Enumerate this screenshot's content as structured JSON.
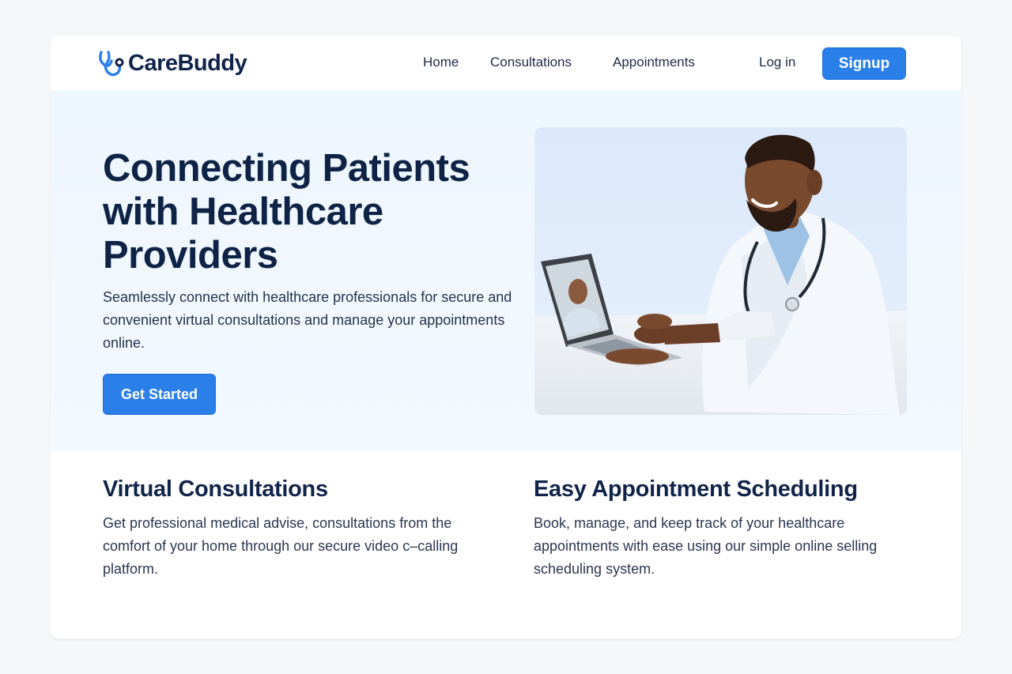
{
  "brand": {
    "name": "CareBuddy",
    "icon": "stethoscope-icon",
    "color": "#2a7fe8"
  },
  "nav": {
    "home": "Home",
    "consultations": "Consultations",
    "appointments": "Appointments",
    "login": "Log in",
    "signup": "Signup"
  },
  "hero": {
    "title": "Connecting Patients with Healthcare Providers",
    "subtitle": "Seamlessly connect with healthcare professionals for secure and convenient virtual consultations and manage your appointments online.",
    "cta": "Get Started",
    "image": "doctor-at-laptop-video-call-photo"
  },
  "features": [
    {
      "title": "Virtual Consultations",
      "text": "Get professional medical advise, consultations from the comfort of your home through our secure video c–calling platform."
    },
    {
      "title": "Easy Appointment Scheduling",
      "text": "Book, manage, and keep track of your healthcare appointments with ease using our simple online selling scheduling system."
    }
  ],
  "colors": {
    "primary": "#2a7fe8",
    "heading": "#0f2347",
    "hero_bg": "#eef6fe"
  }
}
